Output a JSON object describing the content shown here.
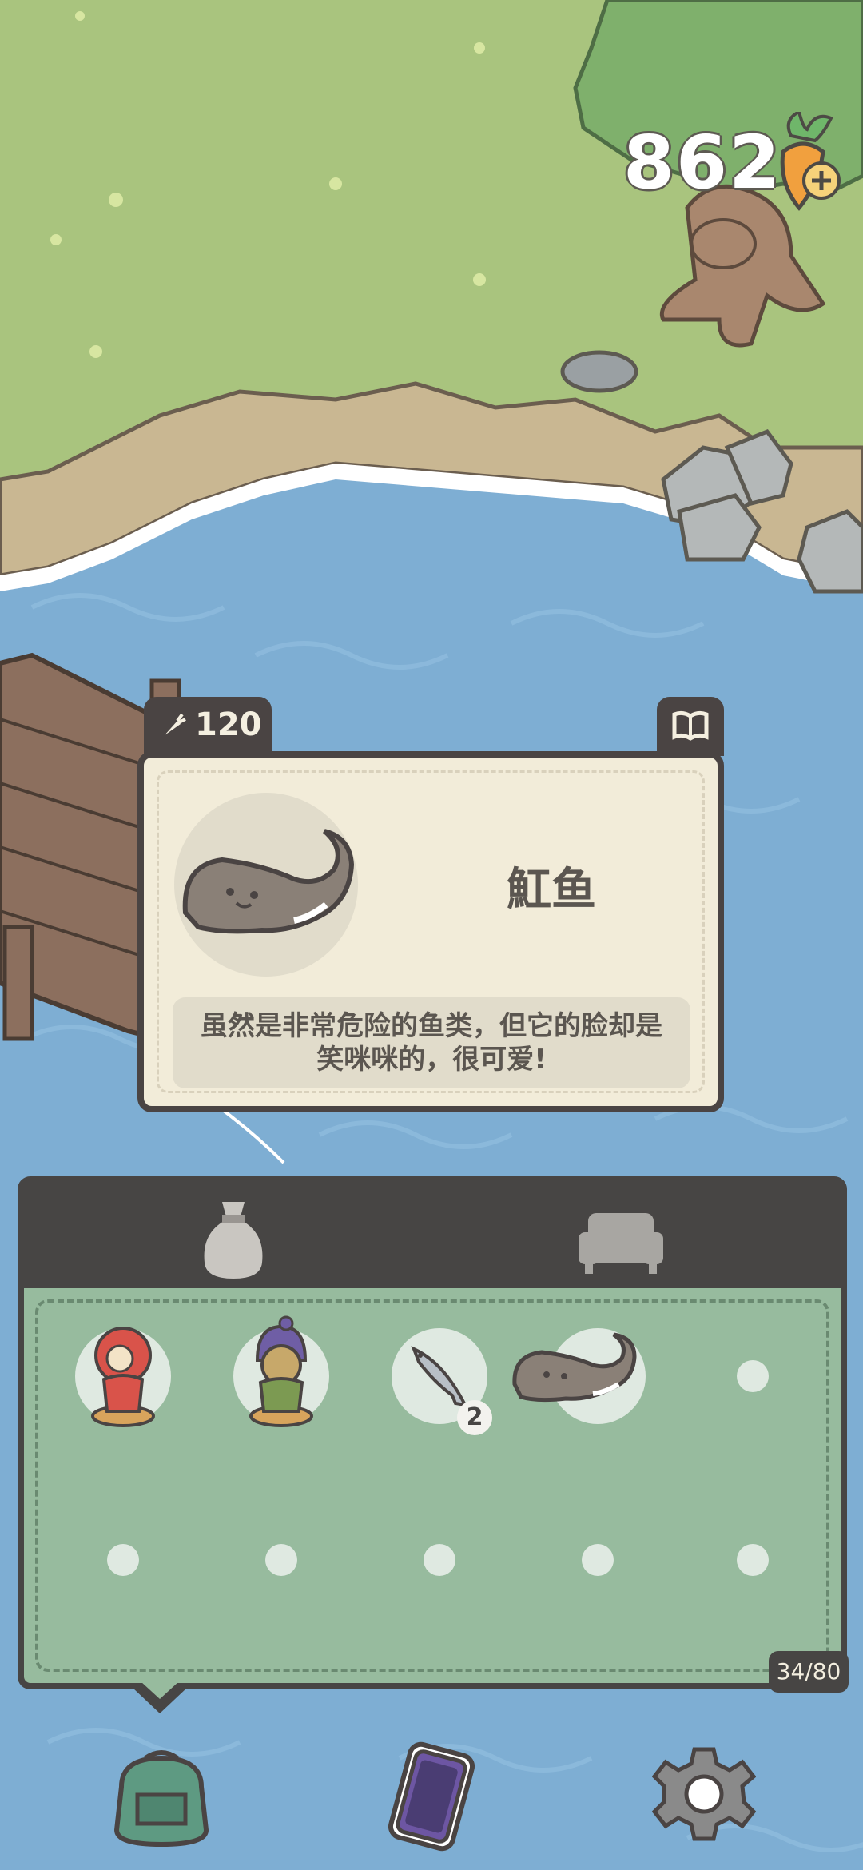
{
  "hud": {
    "carrot_count": "862",
    "carrot_icon": "carrot-add-icon"
  },
  "fish_card": {
    "price": "120",
    "price_icon": "carrot-icon",
    "book_icon": "book-icon",
    "name": "魟鱼",
    "description": "虽然是非常危险的鱼类，但它的脸却是笑咪咪的，很可爱!"
  },
  "inventory": {
    "tabs": [
      {
        "icon": "bag-icon",
        "active": true
      },
      {
        "icon": "sofa-icon",
        "active": false
      }
    ],
    "items": [
      {
        "icon": "red-hooded-figure-icon"
      },
      {
        "icon": "purple-hat-figure-icon"
      },
      {
        "icon": "small-fish-icon",
        "count": "2"
      },
      {
        "icon": "stingray-icon"
      }
    ],
    "capacity": "34/80"
  },
  "bottom_nav": [
    {
      "icon": "backpack-icon"
    },
    {
      "icon": "phone-icon"
    },
    {
      "icon": "gear-icon"
    }
  ],
  "colors": {
    "panel_dark": "#474544",
    "panel_green": "#97bb9e",
    "card_bg": "#f2ecd9",
    "water": "#7eaed3",
    "grass": "#a9c47e"
  }
}
